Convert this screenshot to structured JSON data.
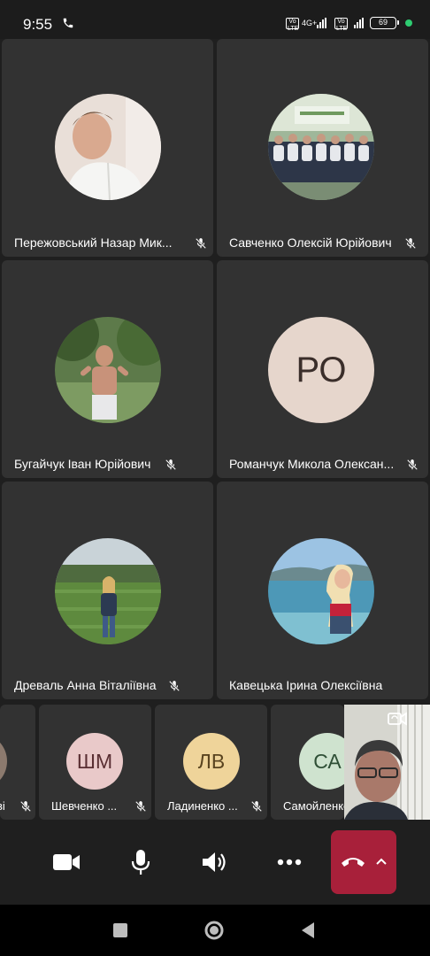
{
  "status_bar": {
    "time": "9:55",
    "network": "4G+",
    "volte": "Vo LTE",
    "battery": "69"
  },
  "participants": [
    {
      "name": "Пережовський Назар Мик...",
      "muted": true,
      "avatar": "photo-portrait"
    },
    {
      "name": "Савченко Олексій Юрійович",
      "muted": true,
      "avatar": "photo-team"
    },
    {
      "name": "Бугайчук Іван Юрійович",
      "muted": true,
      "avatar": "photo-athlete"
    },
    {
      "name": "Романчук Микола Олексан...",
      "muted": true,
      "initials": "РО",
      "avatar_color": "#e6d6cc"
    },
    {
      "name": "Древаль Анна Віталіївна",
      "muted": true,
      "avatar": "photo-field"
    },
    {
      "name": "Кавецька Ірина Олексіївна",
      "muted": false,
      "avatar": "photo-sea"
    }
  ],
  "strip": [
    {
      "name": "ві",
      "muted": true
    },
    {
      "name": "Шевченко ...",
      "initials": "ШМ",
      "muted": true,
      "avatar_color": "#e9c9c9",
      "text_color": "#5a2f33"
    },
    {
      "name": "Ладиненко ...",
      "initials": "ЛВ",
      "muted": true,
      "avatar_color": "#efd49a",
      "text_color": "#5a4420"
    },
    {
      "name": "Самойленко",
      "initials": "СА",
      "muted": false,
      "avatar_color": "#cfe3cf",
      "text_color": "#2f4f36"
    }
  ],
  "controls": [
    "camera",
    "microphone",
    "speaker",
    "more",
    "end-call"
  ]
}
